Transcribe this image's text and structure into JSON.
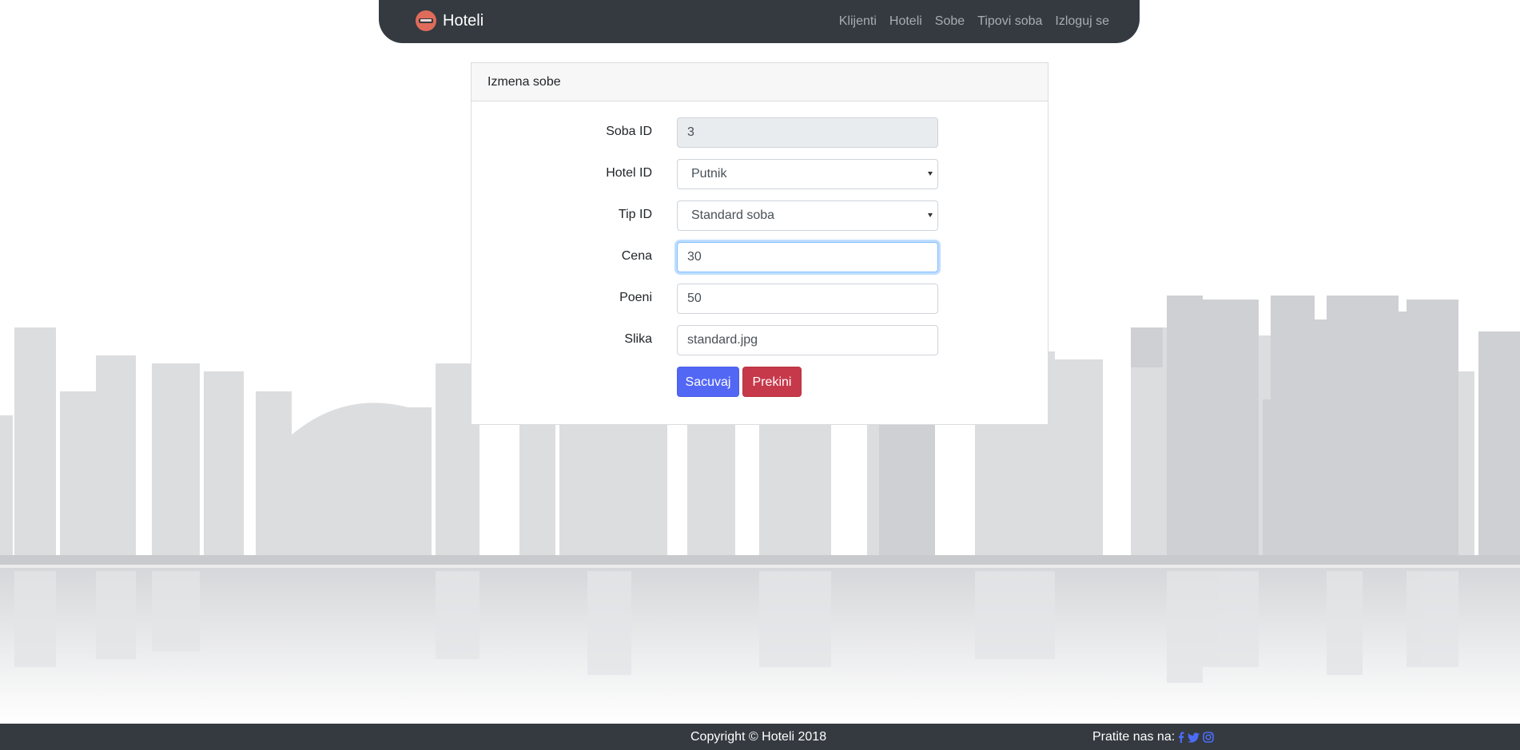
{
  "navbar": {
    "brand": "Hoteli",
    "links": [
      "Klijenti",
      "Hoteli",
      "Sobe",
      "Tipovi soba",
      "Izloguj se"
    ]
  },
  "card": {
    "header": "Izmena sobe",
    "fields": {
      "soba_id": {
        "label": "Soba ID",
        "value": "3"
      },
      "hotel_id": {
        "label": "Hotel ID",
        "value": "Putnik"
      },
      "tip_id": {
        "label": "Tip ID",
        "value": "Standard soba"
      },
      "cena": {
        "label": "Cena",
        "value": "30"
      },
      "poeni": {
        "label": "Poeni",
        "value": "50"
      },
      "slika": {
        "label": "Slika",
        "value": "standard.jpg"
      }
    },
    "buttons": {
      "save": "Sacuvaj",
      "cancel": "Prekini"
    }
  },
  "footer": {
    "copyright": "Copyright © Hoteli 2018",
    "follow_label": "Pratite nas na:",
    "social_icons": [
      "facebook-icon",
      "twitter-icon",
      "instagram-icon"
    ]
  },
  "colors": {
    "navbar_bg": "#343a40",
    "primary": "#5367f5",
    "danger": "#c6394a",
    "social_link": "#4b6cf7"
  }
}
